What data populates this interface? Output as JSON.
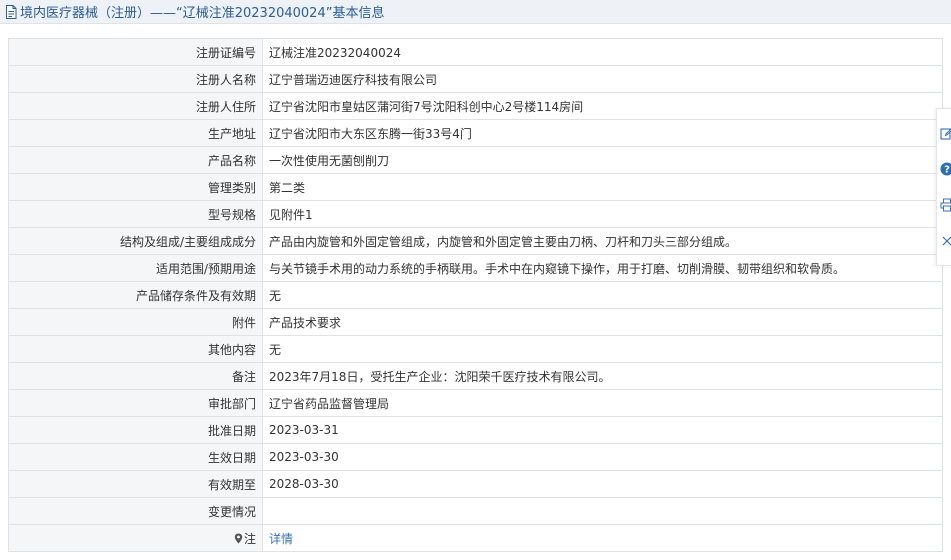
{
  "header": {
    "title": "境内医疗器械（注册）——“辽械注准20232040024”基本信息"
  },
  "rows": [
    {
      "label": "注册证编号",
      "value": "辽械注准20232040024"
    },
    {
      "label": "注册人名称",
      "value": "辽宁普瑞迈迪医疗科技有限公司"
    },
    {
      "label": "注册人住所",
      "value": "辽宁省沈阳市皇姑区蒲河街7号沈阳科创中心2号楼114房间"
    },
    {
      "label": "生产地址",
      "value": "辽宁省沈阳市大东区东腾一街33号4门"
    },
    {
      "label": "产品名称",
      "value": "一次性使用无菌刨削刀"
    },
    {
      "label": "管理类别",
      "value": "第二类"
    },
    {
      "label": "型号规格",
      "value": "见附件1"
    },
    {
      "label": "结构及组成/主要组成成分",
      "value": "产品由内旋管和外固定管组成，内旋管和外固定管主要由刀柄、刀杆和刀头三部分组成。"
    },
    {
      "label": "适用范围/预期用途",
      "value": "与关节镜手术用的动力系统的手柄联用。手术中在内窥镜下操作，用于打磨、切削滑膜、韧带组织和软骨质。"
    },
    {
      "label": "产品储存条件及有效期",
      "value": "无"
    },
    {
      "label": "附件",
      "value": "产品技术要求"
    },
    {
      "label": "其他内容",
      "value": "无"
    },
    {
      "label": "备注",
      "value": "2023年7月18日，受托生产企业：沈阳荣千医疗技术有限公司。"
    },
    {
      "label": "审批部门",
      "value": "辽宁省药品监督管理局"
    },
    {
      "label": "批准日期",
      "value": "2023-03-31"
    },
    {
      "label": "生效日期",
      "value": "2023-03-30"
    },
    {
      "label": "有效期至",
      "value": "2028-03-30"
    },
    {
      "label": "变更情况",
      "value": ""
    }
  ],
  "note_row": {
    "label": "注",
    "link": "详情",
    "icon": "map-pin-icon"
  },
  "side_toolbar": {
    "icons": [
      "edit-icon",
      "help-icon",
      "print-icon",
      "close-icon"
    ]
  },
  "colors": {
    "title_text": "#2a5d9a",
    "title_bg": "#eef1f5",
    "label_bg": "#f4f6f8",
    "border": "#dfe3e8",
    "link": "#3a6fb5",
    "help_badge": "#2f6db5"
  }
}
